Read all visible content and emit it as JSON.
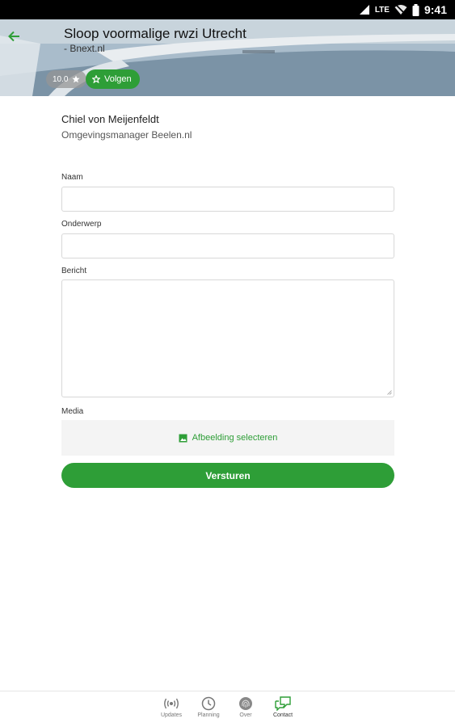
{
  "status_bar": {
    "time": "9:41",
    "network": "LTE",
    "icons": [
      "signal-icon",
      "wifi-off-icon",
      "battery-icon"
    ]
  },
  "header": {
    "title": "Sloop voormalige rwzi Utrecht",
    "subtitle": "- Bnext.nl",
    "rating": "10.0",
    "follow_label": "Volgen"
  },
  "contact": {
    "name": "Chiel von Meijenfeldt",
    "role": "Omgevingsmanager Beelen.nl"
  },
  "form": {
    "name_label": "Naam",
    "name_value": "",
    "subject_label": "Onderwerp",
    "subject_value": "",
    "message_label": "Bericht",
    "message_value": "",
    "media_label": "Media",
    "media_button": "Afbeelding selecteren",
    "submit_label": "Versturen"
  },
  "bottom_nav": {
    "items": [
      {
        "label": "Updates",
        "icon": "broadcast-icon",
        "active": false
      },
      {
        "label": "Planning",
        "icon": "clock-icon",
        "active": false
      },
      {
        "label": "Over",
        "icon": "fingerprint-icon",
        "active": false
      },
      {
        "label": "Contact",
        "icon": "chat-icon",
        "active": true
      }
    ]
  },
  "colors": {
    "accent": "#2e9e37",
    "status_bar": "#000000"
  }
}
